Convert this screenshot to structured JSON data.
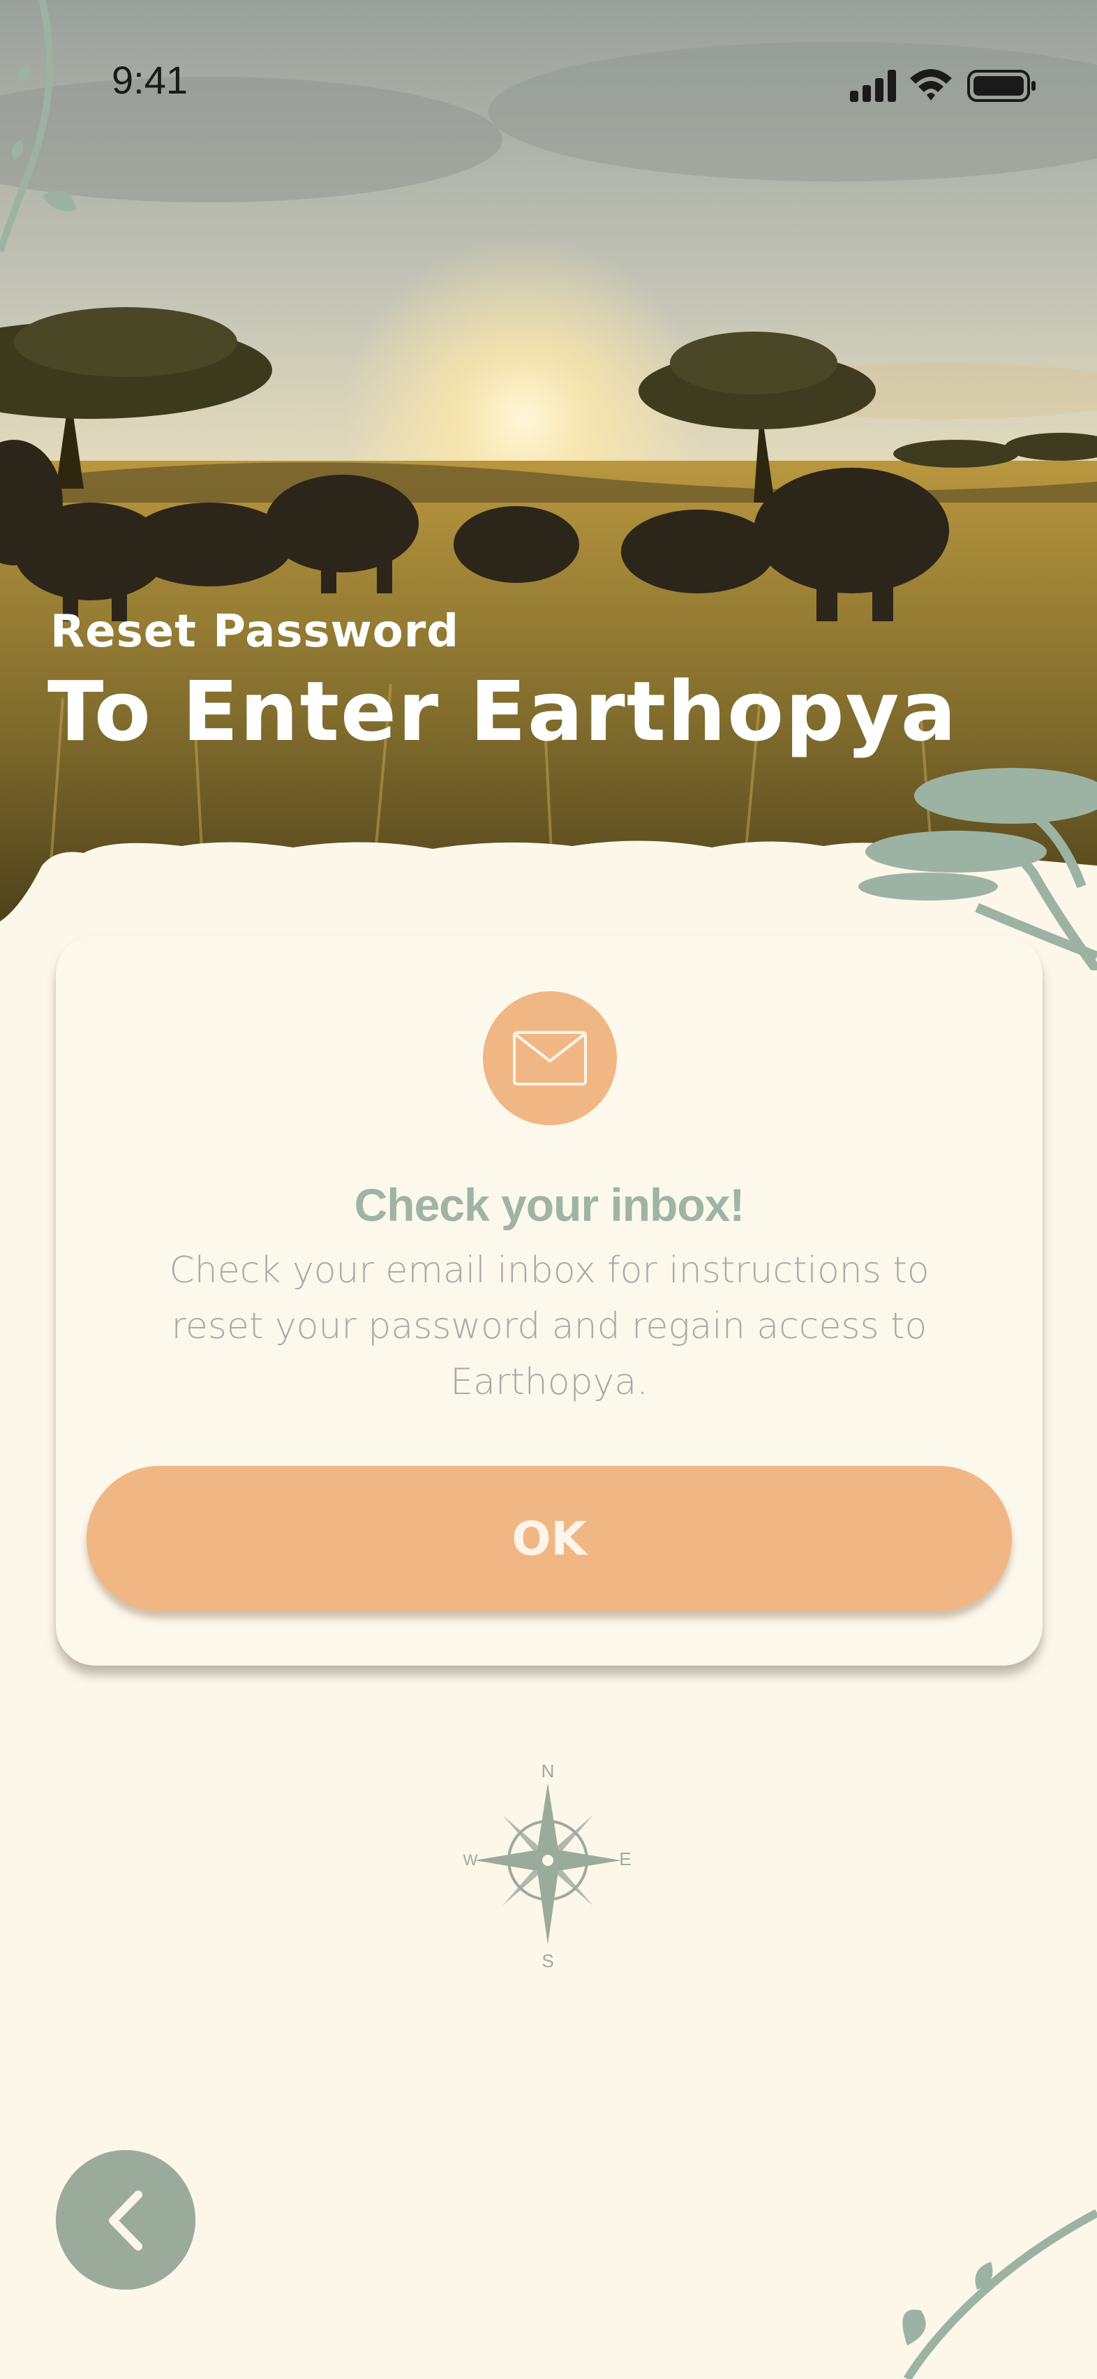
{
  "status_bar": {
    "time": "9:41"
  },
  "hero": {
    "subtitle": "Reset Password",
    "title": "To Enter Earthopya"
  },
  "card": {
    "icon": "mail-icon",
    "title": "Check your inbox!",
    "body": "Check your email inbox for instructions to reset your password and regain access to Earthopya.",
    "ok_label": "OK"
  },
  "compass": {
    "n": "N",
    "s": "S",
    "e": "E",
    "w": "W"
  },
  "navigation": {
    "back_icon": "chevron-left-icon"
  },
  "colors": {
    "background": "#fdf7ea",
    "accent": "#f0b784",
    "sage": "#9aab9c",
    "title": "#9eb4a4",
    "body_text": "#a9a9a6"
  }
}
